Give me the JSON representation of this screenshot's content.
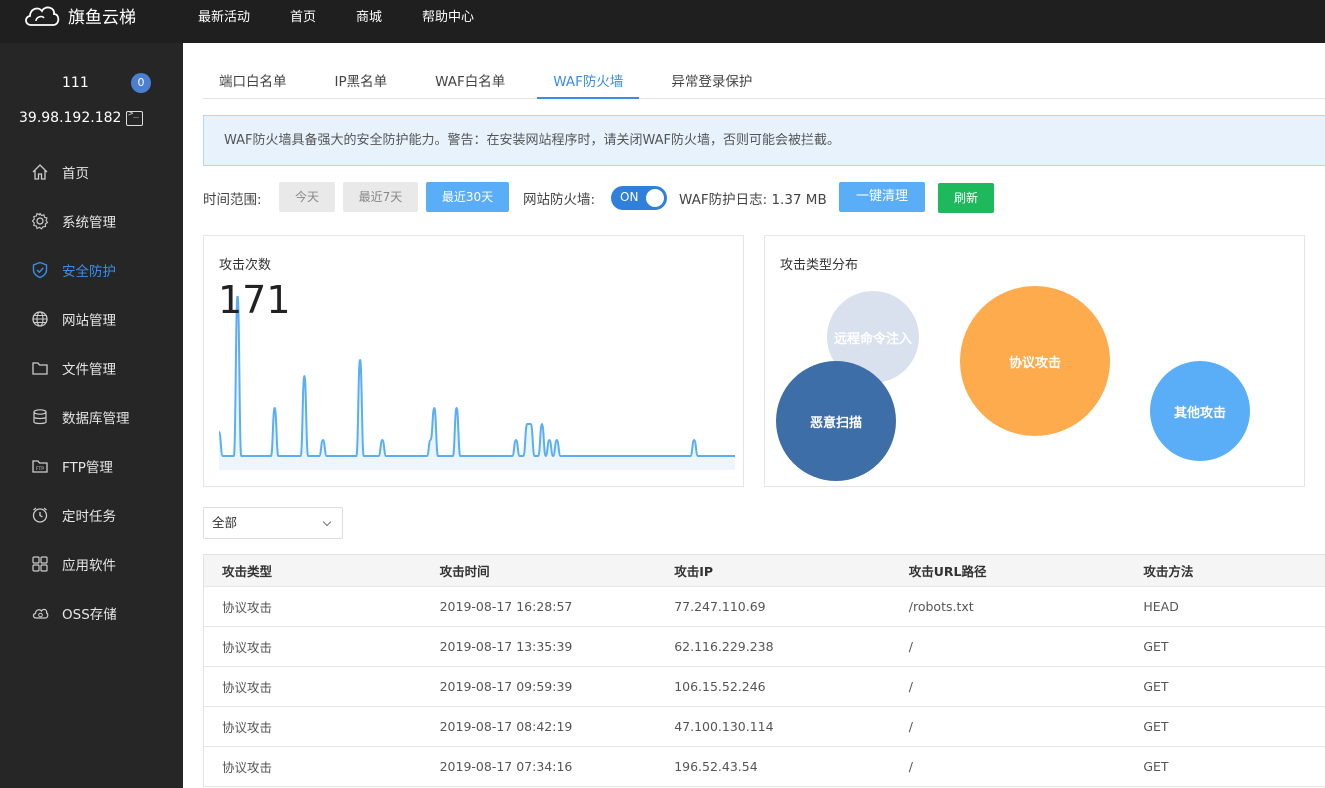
{
  "brand": {
    "name": "旗鱼云梯"
  },
  "topnav": {
    "items": [
      "最新活动",
      "首页",
      "商城",
      "帮助中心"
    ]
  },
  "user": {
    "name": "111",
    "badge": "0",
    "ip": "39.98.192.182"
  },
  "sidebar": {
    "items": [
      {
        "label": "首页",
        "icon": "home-icon"
      },
      {
        "label": "系统管理",
        "icon": "gear-icon"
      },
      {
        "label": "安全防护",
        "icon": "shield-icon"
      },
      {
        "label": "网站管理",
        "icon": "globe-icon"
      },
      {
        "label": "文件管理",
        "icon": "folder-icon"
      },
      {
        "label": "数据库管理",
        "icon": "database-icon"
      },
      {
        "label": "FTP管理",
        "icon": "ftp-icon"
      },
      {
        "label": "定时任务",
        "icon": "clock-icon"
      },
      {
        "label": "应用软件",
        "icon": "apps-icon"
      },
      {
        "label": "OSS存储",
        "icon": "cloud-icon"
      }
    ],
    "active_index": 2
  },
  "tabs": {
    "items": [
      "端口白名单",
      "IP黑名单",
      "WAF白名单",
      "WAF防火墙",
      "异常登录保护"
    ],
    "active_index": 3
  },
  "notice": {
    "text": "WAF防火墙具备强大的安全防护能力。警告：在安装网站程序时，请关闭WAF防火墙，否则可能会被拦截。"
  },
  "filter": {
    "range_label": "时间范围:",
    "range_buttons": [
      "今天",
      "最近7天",
      "最近30天"
    ],
    "range_active": 2,
    "firewall_label": "网站防火墙:",
    "firewall_toggle": "ON",
    "log_label": "WAF防护日志: 1.37 MB",
    "clear_button": "一键清理",
    "refresh_button": "刷新"
  },
  "attack_count": {
    "title": "攻击次数",
    "total": "171",
    "chart_data": {
      "type": "area",
      "values": [
        0.15,
        0,
        0,
        0,
        0,
        1.0,
        0,
        0,
        0,
        0,
        0,
        0,
        0,
        0,
        0,
        0.3,
        0,
        0,
        0,
        0,
        0,
        0,
        0,
        0.5,
        0,
        0,
        0,
        0,
        0.1,
        0,
        0,
        0,
        0,
        0,
        0,
        0,
        0,
        0,
        0.6,
        0,
        0,
        0,
        0,
        0,
        0.1,
        0,
        0,
        0,
        0,
        0,
        0,
        0,
        0,
        0,
        0,
        0,
        0,
        0.1,
        0.3,
        0,
        0,
        0,
        0,
        0,
        0.3,
        0,
        0,
        0,
        0,
        0,
        0,
        0,
        0,
        0,
        0,
        0,
        0,
        0,
        0,
        0,
        0.1,
        0,
        0,
        0.2,
        0.2,
        0,
        0,
        0.2,
        0,
        0.1,
        0,
        0.1,
        0,
        0,
        0,
        0,
        0,
        0,
        0,
        0,
        0,
        0,
        0,
        0,
        0,
        0,
        0,
        0,
        0,
        0,
        0,
        0,
        0,
        0,
        0,
        0,
        0,
        0,
        0,
        0,
        0,
        0,
        0,
        0,
        0,
        0,
        0,
        0,
        0.1,
        0,
        0,
        0,
        0,
        0,
        0,
        0,
        0,
        0,
        0,
        0
      ],
      "color": "#5aaef8"
    }
  },
  "attack_types": {
    "title": "攻击类型分布",
    "bubbles": [
      {
        "label": "远程命令注入",
        "color": "#d9e0ee"
      },
      {
        "label": "协议攻击",
        "color": "#fdab4d"
      },
      {
        "label": "恶意扫描",
        "color": "#3d6ea8"
      },
      {
        "label": "其他攻击",
        "color": "#5aaef8"
      }
    ]
  },
  "filter_select": {
    "value": "全部"
  },
  "table": {
    "headers": [
      "攻击类型",
      "攻击时间",
      "攻击IP",
      "攻击URL路径",
      "攻击方法"
    ],
    "rows": [
      [
        "协议攻击",
        "2019-08-17 16:28:57",
        "77.247.110.69",
        "/robots.txt",
        "HEAD"
      ],
      [
        "协议攻击",
        "2019-08-17 13:35:39",
        "62.116.229.238",
        "/",
        "GET"
      ],
      [
        "协议攻击",
        "2019-08-17 09:59:39",
        "106.15.52.246",
        "/",
        "GET"
      ],
      [
        "协议攻击",
        "2019-08-17 08:42:19",
        "47.100.130.114",
        "/",
        "GET"
      ],
      [
        "协议攻击",
        "2019-08-17 07:34:16",
        "196.52.43.54",
        "/",
        "GET"
      ]
    ]
  }
}
